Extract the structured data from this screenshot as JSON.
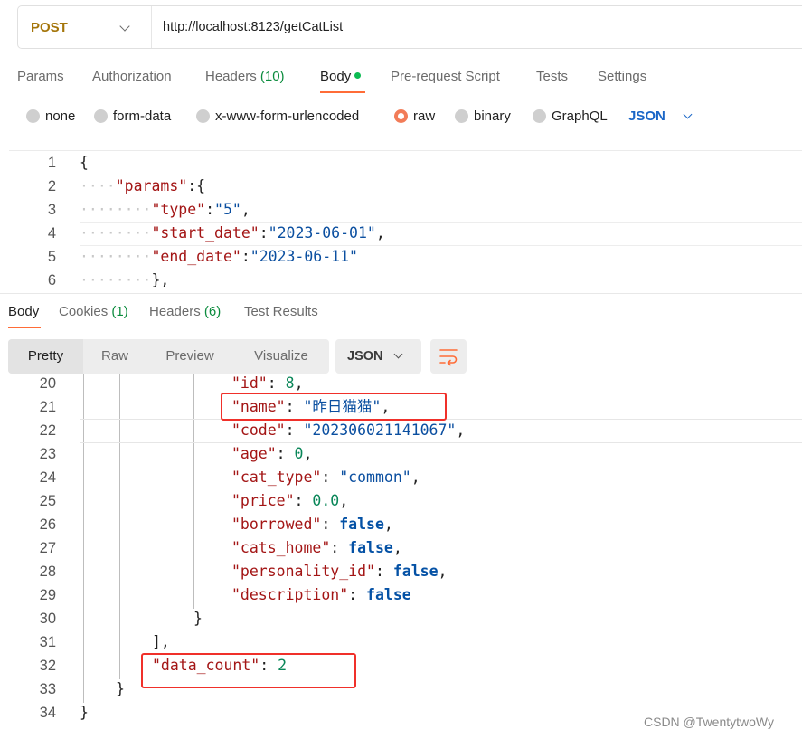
{
  "request": {
    "method": "POST",
    "url": "http://localhost:8123/getCatList"
  },
  "request_tabs": [
    {
      "label": "Params"
    },
    {
      "label": "Authorization"
    },
    {
      "label": "Headers",
      "count": "(10)"
    },
    {
      "label": "Body"
    },
    {
      "label": "Pre-request Script"
    },
    {
      "label": "Tests"
    },
    {
      "label": "Settings"
    }
  ],
  "body_types": [
    {
      "label": "none"
    },
    {
      "label": "form-data"
    },
    {
      "label": "x-www-form-urlencoded"
    },
    {
      "label": "raw"
    },
    {
      "label": "binary"
    },
    {
      "label": "GraphQL"
    }
  ],
  "body_format": "JSON",
  "request_code": [
    {
      "n": "1",
      "ws": "",
      "parts": [
        [
          "pun",
          "{"
        ]
      ]
    },
    {
      "n": "2",
      "ws": "····",
      "parts": [
        [
          "key",
          "\"params\""
        ],
        [
          "pun",
          ":{"
        ]
      ]
    },
    {
      "n": "3",
      "ws": "········",
      "parts": [
        [
          "key",
          "\"type\""
        ],
        [
          "pun",
          ":"
        ],
        [
          "str",
          "\"5\""
        ],
        [
          "pun",
          ","
        ]
      ]
    },
    {
      "n": "4",
      "ws": "········",
      "parts": [
        [
          "key",
          "\"start_date\""
        ],
        [
          "pun",
          ":"
        ],
        [
          "str",
          "\"2023-06-01\""
        ],
        [
          "pun",
          ","
        ]
      ]
    },
    {
      "n": "5",
      "ws": "········",
      "parts": [
        [
          "key",
          "\"end_date\""
        ],
        [
          "pun",
          ":"
        ],
        [
          "str",
          "\"2023-06-11\""
        ]
      ]
    },
    {
      "n": "6",
      "ws": "········",
      "parts": [
        [
          "pun",
          "},"
        ]
      ]
    }
  ],
  "response_tabs": [
    {
      "label": "Body"
    },
    {
      "label": "Cookies",
      "count": "(1)"
    },
    {
      "label": "Headers",
      "count": "(6)"
    },
    {
      "label": "Test Results"
    }
  ],
  "view_modes": [
    "Pretty",
    "Raw",
    "Preview",
    "Visualize"
  ],
  "response_format": "JSON",
  "response_code": [
    {
      "n": "20",
      "indent": 4,
      "parts": [
        [
          "key",
          "\"id\""
        ],
        [
          "pun",
          ": "
        ],
        [
          "num",
          "8"
        ],
        [
          "pun",
          ","
        ]
      ]
    },
    {
      "n": "21",
      "indent": 4,
      "parts": [
        [
          "key",
          "\"name\""
        ],
        [
          "pun",
          ": "
        ],
        [
          "str",
          "\"昨日猫猫\""
        ],
        [
          "pun",
          ","
        ]
      ]
    },
    {
      "n": "22",
      "indent": 4,
      "parts": [
        [
          "key",
          "\"code\""
        ],
        [
          "pun",
          ": "
        ],
        [
          "str",
          "\"202306021141067\""
        ],
        [
          "pun",
          ","
        ]
      ]
    },
    {
      "n": "23",
      "indent": 4,
      "parts": [
        [
          "key",
          "\"age\""
        ],
        [
          "pun",
          ": "
        ],
        [
          "num",
          "0"
        ],
        [
          "pun",
          ","
        ]
      ]
    },
    {
      "n": "24",
      "indent": 4,
      "parts": [
        [
          "key",
          "\"cat_type\""
        ],
        [
          "pun",
          ": "
        ],
        [
          "str",
          "\"common\""
        ],
        [
          "pun",
          ","
        ]
      ]
    },
    {
      "n": "25",
      "indent": 4,
      "parts": [
        [
          "key",
          "\"price\""
        ],
        [
          "pun",
          ": "
        ],
        [
          "num",
          "0.0"
        ],
        [
          "pun",
          ","
        ]
      ]
    },
    {
      "n": "26",
      "indent": 4,
      "parts": [
        [
          "key",
          "\"borrowed\""
        ],
        [
          "pun",
          ": "
        ],
        [
          "bool",
          "false"
        ],
        [
          "pun",
          ","
        ]
      ]
    },
    {
      "n": "27",
      "indent": 4,
      "parts": [
        [
          "key",
          "\"cats_home\""
        ],
        [
          "pun",
          ": "
        ],
        [
          "bool",
          "false"
        ],
        [
          "pun",
          ","
        ]
      ]
    },
    {
      "n": "28",
      "indent": 4,
      "parts": [
        [
          "key",
          "\"personality_id\""
        ],
        [
          "pun",
          ": "
        ],
        [
          "bool",
          "false"
        ],
        [
          "pun",
          ","
        ]
      ]
    },
    {
      "n": "29",
      "indent": 4,
      "parts": [
        [
          "key",
          "\"description\""
        ],
        [
          "pun",
          ": "
        ],
        [
          "bool",
          "false"
        ]
      ]
    },
    {
      "n": "30",
      "indent": 3,
      "parts": [
        [
          "pun",
          "}"
        ]
      ]
    },
    {
      "n": "31",
      "indent": 2,
      "parts": [
        [
          "pun",
          "],"
        ]
      ]
    },
    {
      "n": "32",
      "indent": 2,
      "parts": [
        [
          "key",
          "\"data_count\""
        ],
        [
          "pun",
          ": "
        ],
        [
          "num",
          "2"
        ]
      ]
    },
    {
      "n": "33",
      "indent": 1,
      "parts": [
        [
          "pun",
          "}"
        ]
      ]
    },
    {
      "n": "34",
      "indent": 0,
      "parts": [
        [
          "pun",
          "}"
        ]
      ]
    }
  ],
  "watermark": "CSDN @TwentytwoWy",
  "colors": {
    "method": "#a4750a",
    "accent": "#ff6c37",
    "active_dot": "#0cbb52",
    "link_blue": "#1a66c7",
    "highlight_box": "#f0302a"
  },
  "icons": {
    "method_dropdown": "chevron-down-icon",
    "format_dropdown": "chevron-down-icon",
    "wrap": "wrap-lines-icon"
  }
}
